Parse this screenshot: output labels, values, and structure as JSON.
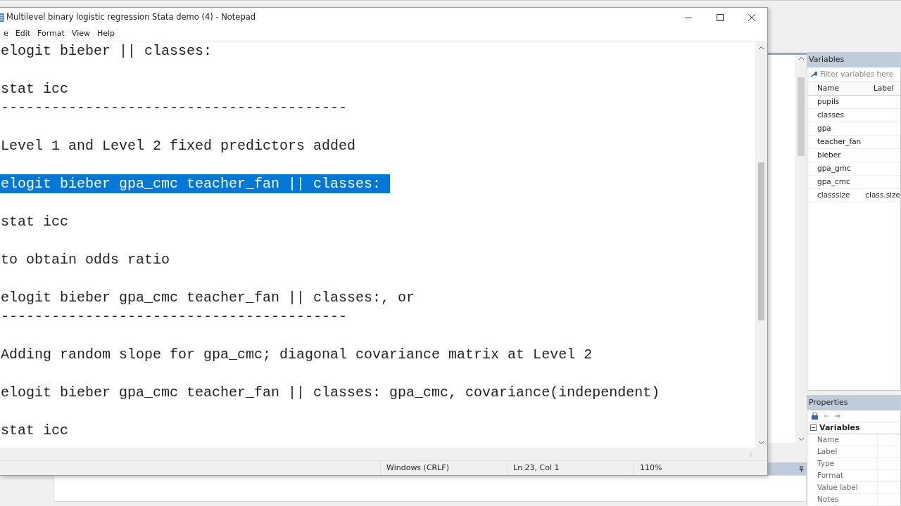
{
  "stata": {
    "variables": {
      "title": "Variables",
      "filter_placeholder": "Filter variables here",
      "columns": [
        "Name",
        "Label"
      ],
      "rows": [
        {
          "name": "pupils",
          "label": ""
        },
        {
          "name": "classes",
          "label": ""
        },
        {
          "name": "gpa",
          "label": ""
        },
        {
          "name": "teacher_fan",
          "label": ""
        },
        {
          "name": "bieber",
          "label": ""
        },
        {
          "name": "gpa_gmc",
          "label": ""
        },
        {
          "name": "gpa_cmc",
          "label": ""
        },
        {
          "name": "classsize",
          "label": "class.size"
        }
      ]
    },
    "properties": {
      "title": "Properties",
      "section": "Variables",
      "expanded": true,
      "fields": [
        "Name",
        "Label",
        "Type",
        "Format",
        "Value label",
        "Notes"
      ]
    }
  },
  "notepad": {
    "title": "Multilevel binary logistic regression Stata demo (4) - Notepad",
    "menu": [
      "e",
      "Edit",
      "Format",
      "View",
      "Help"
    ],
    "lines": [
      {
        "kind": "text",
        "text": "elogit bieber || classes:",
        "selected": false
      },
      {
        "kind": "blank"
      },
      {
        "kind": "text",
        "text": "stat icc",
        "selected": false
      },
      {
        "kind": "text",
        "text": "-----------------------------------------",
        "selected": false
      },
      {
        "kind": "blank"
      },
      {
        "kind": "text",
        "text": "Level 1 and Level 2 fixed predictors added",
        "selected": false
      },
      {
        "kind": "blank"
      },
      {
        "kind": "text",
        "text": "elogit bieber gpa_cmc teacher_fan || classes:",
        "selected": true
      },
      {
        "kind": "blank"
      },
      {
        "kind": "text",
        "text": "stat icc",
        "selected": false
      },
      {
        "kind": "blank"
      },
      {
        "kind": "text",
        "text": "to obtain odds ratio",
        "selected": false
      },
      {
        "kind": "blank"
      },
      {
        "kind": "text",
        "text": "elogit bieber gpa_cmc teacher_fan || classes:, or",
        "selected": false
      },
      {
        "kind": "text",
        "text": "-----------------------------------------",
        "selected": false
      },
      {
        "kind": "blank"
      },
      {
        "kind": "text",
        "text": "Adding random slope for gpa_cmc; diagonal covariance matrix at Level 2",
        "selected": false
      },
      {
        "kind": "blank"
      },
      {
        "kind": "text",
        "text": "elogit bieber gpa_cmc teacher_fan || classes: gpa_cmc, covariance(independent)",
        "selected": false
      },
      {
        "kind": "blank"
      },
      {
        "kind": "text",
        "text": "stat icc",
        "selected": false
      }
    ],
    "status_bar": [
      "Windows (CRLF)",
      "Ln 23, Col 1",
      "110%"
    ]
  }
}
